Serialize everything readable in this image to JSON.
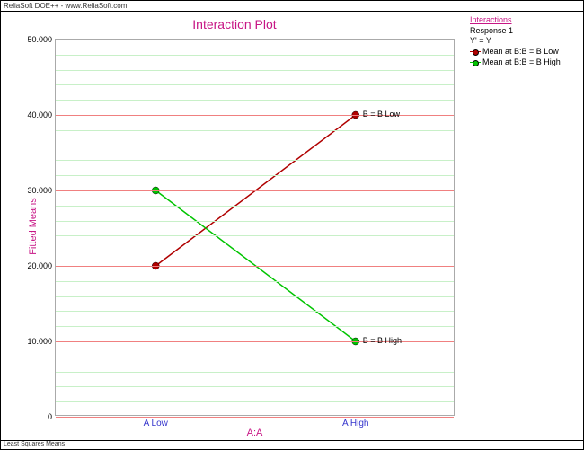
{
  "window": {
    "title": "ReliaSoft DOE++ - www.ReliaSoft.com",
    "footer": "Least Squares Means"
  },
  "chart_data": {
    "type": "line",
    "title": "Interaction Plot",
    "xlabel": "A:A",
    "ylabel": "Fitted Means",
    "ylim": [
      0,
      50
    ],
    "ytick_labels": [
      "0",
      "10.000",
      "20.000",
      "30.000",
      "40.000",
      "50.000"
    ],
    "categories": [
      "A Low",
      "A High"
    ],
    "series": [
      {
        "name": "Mean at B:B = B Low",
        "color_hex": "#b00000",
        "values": [
          20,
          40
        ],
        "end_label": "B = B Low"
      },
      {
        "name": "Mean at B:B = B High",
        "color_hex": "#00c400",
        "values": [
          30,
          10
        ],
        "end_label": "B = B High"
      }
    ],
    "point_labels": [
      {
        "series": 0,
        "idx": 1,
        "text": "B = B Low"
      },
      {
        "series": 1,
        "idx": 1,
        "text": "B = B High"
      }
    ]
  },
  "legend": {
    "title": "Interactions",
    "response": "Response 1",
    "transform": "Y' = Y",
    "items": [
      {
        "label": "Mean at B:B = B Low",
        "color": "red"
      },
      {
        "label": "Mean at B:B = B High",
        "color": "green"
      }
    ]
  }
}
